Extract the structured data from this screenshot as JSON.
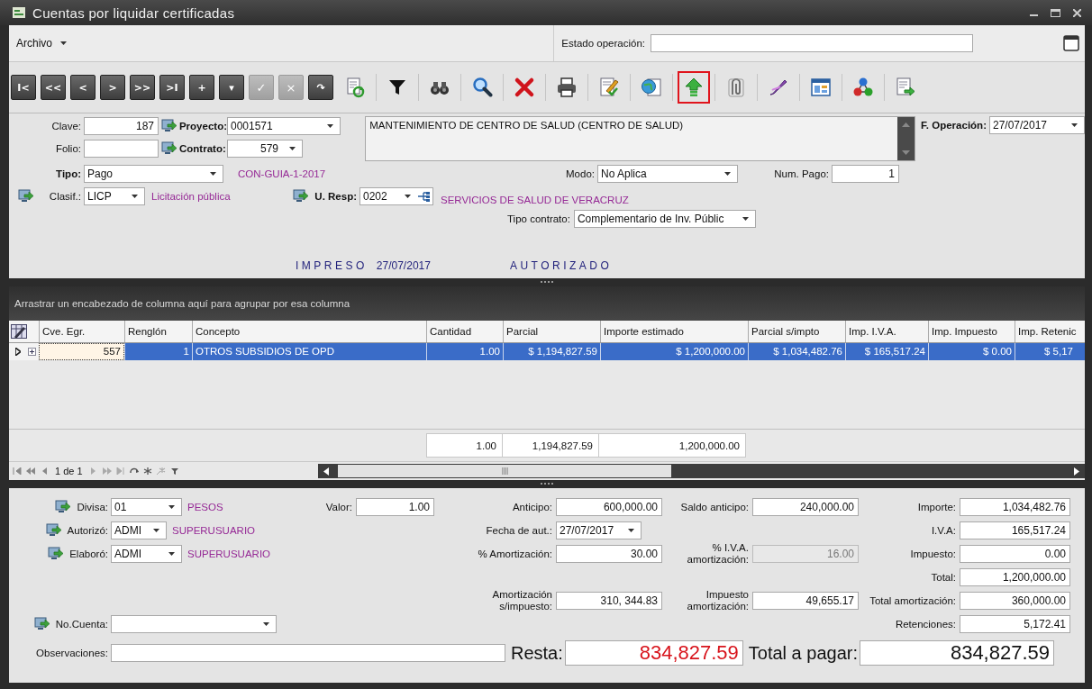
{
  "window": {
    "title": "Cuentas por liquidar certificadas"
  },
  "menu": {
    "archivo": "Archivo",
    "estado_label": "Estado operación:"
  },
  "toolbar": {
    "nav_buttons": [
      {
        "label": "I<",
        "disabled": false
      },
      {
        "label": "<<",
        "disabled": false
      },
      {
        "label": "<",
        "disabled": false
      },
      {
        "label": ">",
        "disabled": false
      },
      {
        "label": ">>",
        "disabled": false
      },
      {
        "label": ">I",
        "disabled": false
      },
      {
        "label": "+",
        "disabled": false
      },
      {
        "label": "▾",
        "disabled": false
      },
      {
        "label": "✓",
        "disabled": true
      },
      {
        "label": "×",
        "disabled": true
      },
      {
        "label": "↷",
        "disabled": false
      }
    ],
    "tools": [
      {
        "highlighted": false
      },
      {
        "highlighted": false
      },
      {
        "highlighted": false
      },
      {
        "highlighted": false
      },
      {
        "highlighted": false
      },
      {
        "highlighted": false
      },
      {
        "highlighted": false
      },
      {
        "highlighted": false
      },
      {
        "highlighted": true
      },
      {
        "highlighted": false
      },
      {
        "highlighted": false
      },
      {
        "highlighted": false
      },
      {
        "highlighted": false
      },
      {
        "highlighted": false
      }
    ]
  },
  "header": {
    "clave": {
      "label": "Clave:",
      "value": "187"
    },
    "folio": {
      "label": "Folio:"
    },
    "proyecto": {
      "label": "Proyecto:",
      "value": "0001571"
    },
    "contrato": {
      "label": "Contrato:",
      "value": "579"
    },
    "descripcion": "MANTENIMIENTO DE CENTRO DE SALUD (CENTRO DE SALUD)",
    "f_operacion": {
      "label": "F. Operación:",
      "value": "27/07/2017"
    },
    "tipo": {
      "label": "Tipo:",
      "value": "Pago"
    },
    "guia": "CON-GUIA-1-2017",
    "modo": {
      "label": "Modo:",
      "value": "No Aplica"
    },
    "num_pago": {
      "label": "Num. Pago:",
      "value": "1"
    },
    "clasif": {
      "label": "Clasif.:",
      "value": "LICP",
      "description": "Licitación pública"
    },
    "u_resp": {
      "label": "U. Resp:",
      "value": "0202",
      "description": "SERVICIOS DE SALUD DE VERACRUZ"
    },
    "tipo_contrato": {
      "label": "Tipo contrato:",
      "value": "Complementario de Inv. Públic"
    },
    "impreso": "IMPRESO",
    "impreso_fecha": "27/07/2017",
    "autorizado": "AUTORIZADO"
  },
  "grid": {
    "group_hint": "Arrastrar un encabezado de columna aquí para agrupar por esa columna",
    "columns": [
      "Cve. Egr.",
      "Renglón",
      "Concepto",
      "Cantidad",
      "Parcial",
      "Importe estimado",
      "Parcial s/impto",
      "Imp. I.V.A.",
      "Imp. Impuesto",
      "Imp. Retenic"
    ],
    "rows": [
      {
        "selected": true,
        "cells": [
          {
            "text": "557",
            "focused": true
          },
          {
            "text": "1",
            "focused": false
          },
          {
            "text": "OTROS SUBSIDIOS DE OPD",
            "focused": false
          },
          {
            "text": "1.00",
            "focused": false
          },
          {
            "text": "$ 1,194,827.59",
            "focused": false
          },
          {
            "text": "$ 1,200,000.00",
            "focused": false
          },
          {
            "text": "$ 1,034,482.76",
            "focused": false
          },
          {
            "text": "$ 165,517.24",
            "focused": false
          },
          {
            "text": "$ 0.00",
            "focused": false
          },
          {
            "text": "$ 5,17",
            "focused": false
          }
        ]
      }
    ],
    "totals": [
      "1.00",
      "1,194,827.59",
      "1,200,000.00"
    ],
    "pager": "1 de 1"
  },
  "footer": {
    "divisa": {
      "label": "Divisa:",
      "value": "01",
      "description": "PESOS"
    },
    "valor": {
      "label": "Valor:",
      "value": "1.00"
    },
    "autorizo": {
      "label": "Autorizó:",
      "value": "ADMI",
      "description": "SUPERUSUARIO"
    },
    "elaboro": {
      "label": "Elaboró:",
      "value": "ADMI",
      "description": "SUPERUSUARIO"
    },
    "no_cuenta": {
      "label": "No.Cuenta:"
    },
    "observaciones": {
      "label": "Observaciones:"
    },
    "anticipo": {
      "label": "Anticipo:",
      "value": "600,000.00"
    },
    "fecha_aut": {
      "label": "Fecha de aut.:",
      "value": "27/07/2017"
    },
    "pct_amortizacion": {
      "label": "% Amortización:",
      "value": "30.00"
    },
    "amortizacion_s_impuesto": {
      "label": "Amortización s/impuesto:",
      "value": "310, 344.83"
    },
    "saldo_anticipo": {
      "label": "Saldo anticipo:",
      "value": "240,000.00"
    },
    "pct_iva_amortizacion": {
      "label": "% I.V.A. amortización:",
      "value": "16.00",
      "disabled": true
    },
    "impuesto_amortizacion": {
      "label": "Impuesto amortización:",
      "value": "49,655.17"
    },
    "totals": [
      {
        "label": "Importe:",
        "value": "1,034,482.76"
      },
      {
        "label": "I.V.A:",
        "value": "165,517.24"
      },
      {
        "label": "Impuesto:",
        "value": "0.00"
      },
      {
        "label": "Total:",
        "value": "1,200,000.00"
      },
      {
        "label": "Total amortización:",
        "value": "360,000.00"
      },
      {
        "label": "Retenciones:",
        "value": "5,172.41"
      }
    ],
    "resta": {
      "label": "Resta:",
      "value": "834,827.59"
    },
    "total_a_pagar": {
      "label": "Total a pagar:",
      "value": "834,827.59"
    }
  }
}
